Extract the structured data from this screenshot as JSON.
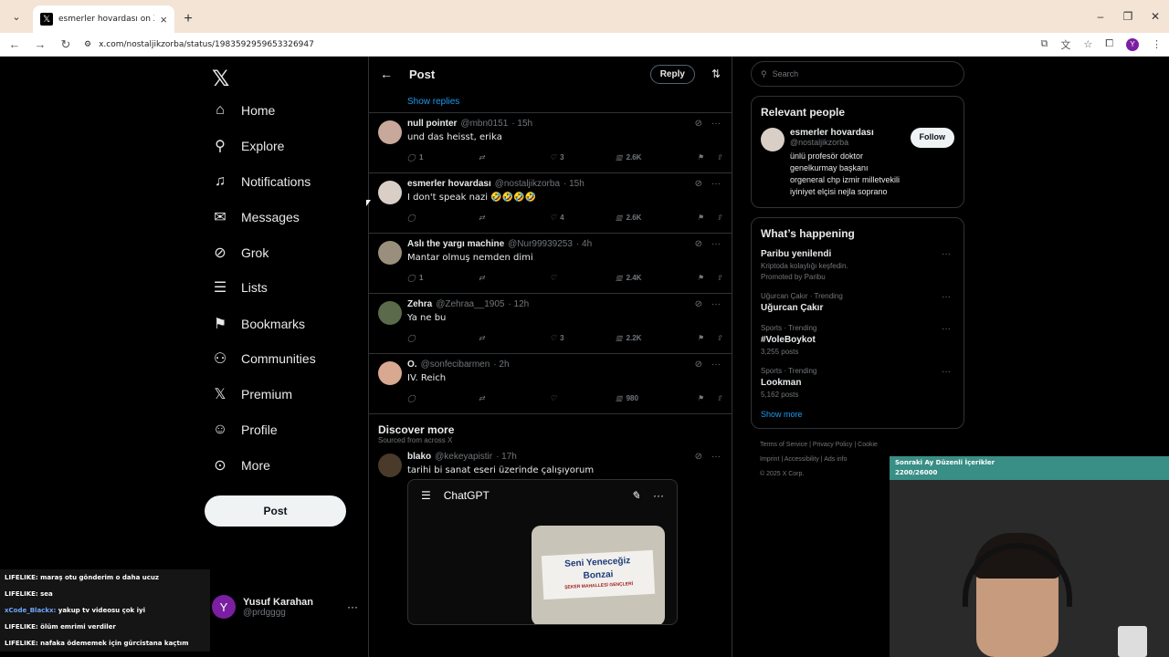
{
  "browser": {
    "tab_title": "esmerler hovardası on X: \"Benim",
    "url": "x.com/nostaljikzorba/status/1983592959653326947"
  },
  "sidebar": {
    "items": [
      {
        "label": "Home",
        "icon": "home-icon"
      },
      {
        "label": "Explore",
        "icon": "search-icon"
      },
      {
        "label": "Notifications",
        "icon": "bell-icon"
      },
      {
        "label": "Messages",
        "icon": "mail-icon"
      },
      {
        "label": "Grok",
        "icon": "grok-icon"
      },
      {
        "label": "Lists",
        "icon": "list-icon"
      },
      {
        "label": "Bookmarks",
        "icon": "bookmark-icon"
      },
      {
        "label": "Communities",
        "icon": "communities-icon"
      },
      {
        "label": "Premium",
        "icon": "x-icon"
      },
      {
        "label": "Profile",
        "icon": "person-icon"
      },
      {
        "label": "More",
        "icon": "more-icon"
      }
    ],
    "post_label": "Post",
    "account": {
      "name": "Yusuf Karahan",
      "handle": "@prdgggg",
      "initial": "Y"
    }
  },
  "main": {
    "title": "Post",
    "reply_label": "Reply",
    "show_replies": "Show replies",
    "tweets": [
      {
        "name": "null pointer",
        "handle": "@mbn0151",
        "time": "· 15h",
        "text": "und das heisst, erika",
        "replies": "1",
        "likes": "3",
        "views": "2.6K"
      },
      {
        "name": "esmerler hovardası",
        "handle": "@nostaljikzorba",
        "time": "· 15h",
        "text": "I don't speak nazi 🤣🤣🤣🤣",
        "replies": "",
        "likes": "4",
        "views": "2.6K"
      },
      {
        "name": "Aslı the yargı machine",
        "handle": "@Nur99939253",
        "time": "· 4h",
        "text": "Mantar olmuş nemden dimi",
        "replies": "1",
        "likes": "",
        "views": "2.4K"
      },
      {
        "name": "Zehra",
        "handle": "@Zehraa__1905",
        "time": "· 12h",
        "text": "Ya ne bu",
        "replies": "",
        "likes": "3",
        "views": "2.2K"
      },
      {
        "name": "O.",
        "handle": "@sonfecibarmen",
        "time": "· 2h",
        "text": "IV. Reich",
        "replies": "",
        "likes": "",
        "views": "980"
      }
    ],
    "discover": {
      "title": "Discover more",
      "subtitle": "Sourced from across X",
      "tweet": {
        "name": "blako",
        "handle": "@kekeyapistir",
        "time": "· 17h",
        "text": "tarihi bi sanat eseri üzerinde çalışıyorum"
      },
      "card_title": "ChatGPT",
      "sign_line1": "Seni Yeneceğiz",
      "sign_line2": "Bonzai",
      "sign_line3": "ŞEKER MAHALLESİ GENÇLERİ"
    }
  },
  "right": {
    "search_placeholder": "Search",
    "relevant_title": "Relevant people",
    "person": {
      "name": "esmerler hovardası",
      "handle": "@nostaljikzorba",
      "bio": "ünlü profesör doktor genelkurmay başkanı orgeneral chp izmir milletvekili iyiniyet elçisi nejla soprano",
      "follow_label": "Follow"
    },
    "happening_title": "What’s happening",
    "trends": [
      {
        "ctx": "",
        "title": "Paribu yenilendi",
        "sub": "Kriptoda kolaylığı keşfedin.",
        "sub2": "Promoted by Paribu"
      },
      {
        "ctx": "Uğurcan Çakır · Trending",
        "title": "Uğurcan Çakır",
        "sub": "",
        "sub2": ""
      },
      {
        "ctx": "Sports · Trending",
        "title": "#VoleBoykot",
        "sub": "3,255 posts",
        "sub2": ""
      },
      {
        "ctx": "Sports · Trending",
        "title": "Lookman",
        "sub": "5,162 posts",
        "sub2": ""
      }
    ],
    "show_more": "Show more",
    "footer": [
      "Terms of Service",
      "Privacy Policy",
      "Cookie",
      "Imprint",
      "Accessibility",
      "Ads info",
      "© 2025 X Corp."
    ]
  },
  "overlay": {
    "chat": [
      {
        "user": "LIFELIKE:",
        "msg": "maraş otu gönderim o daha ucuz"
      },
      {
        "user": "LIFELIKE:",
        "msg": "sea"
      },
      {
        "user": "xCode_Blackx:",
        "msg": "yakup tv videosu çok iyi"
      },
      {
        "user": "LIFELIKE:",
        "msg": "ölüm emrimi verdiler"
      },
      {
        "user": "LIFELIKE:",
        "msg": "nafaka ödememek için gürcistana kaçtım"
      }
    ],
    "banner_line1": "Sonraki Ay Düzenli İçerikler",
    "banner_line2": "2200/26000"
  }
}
